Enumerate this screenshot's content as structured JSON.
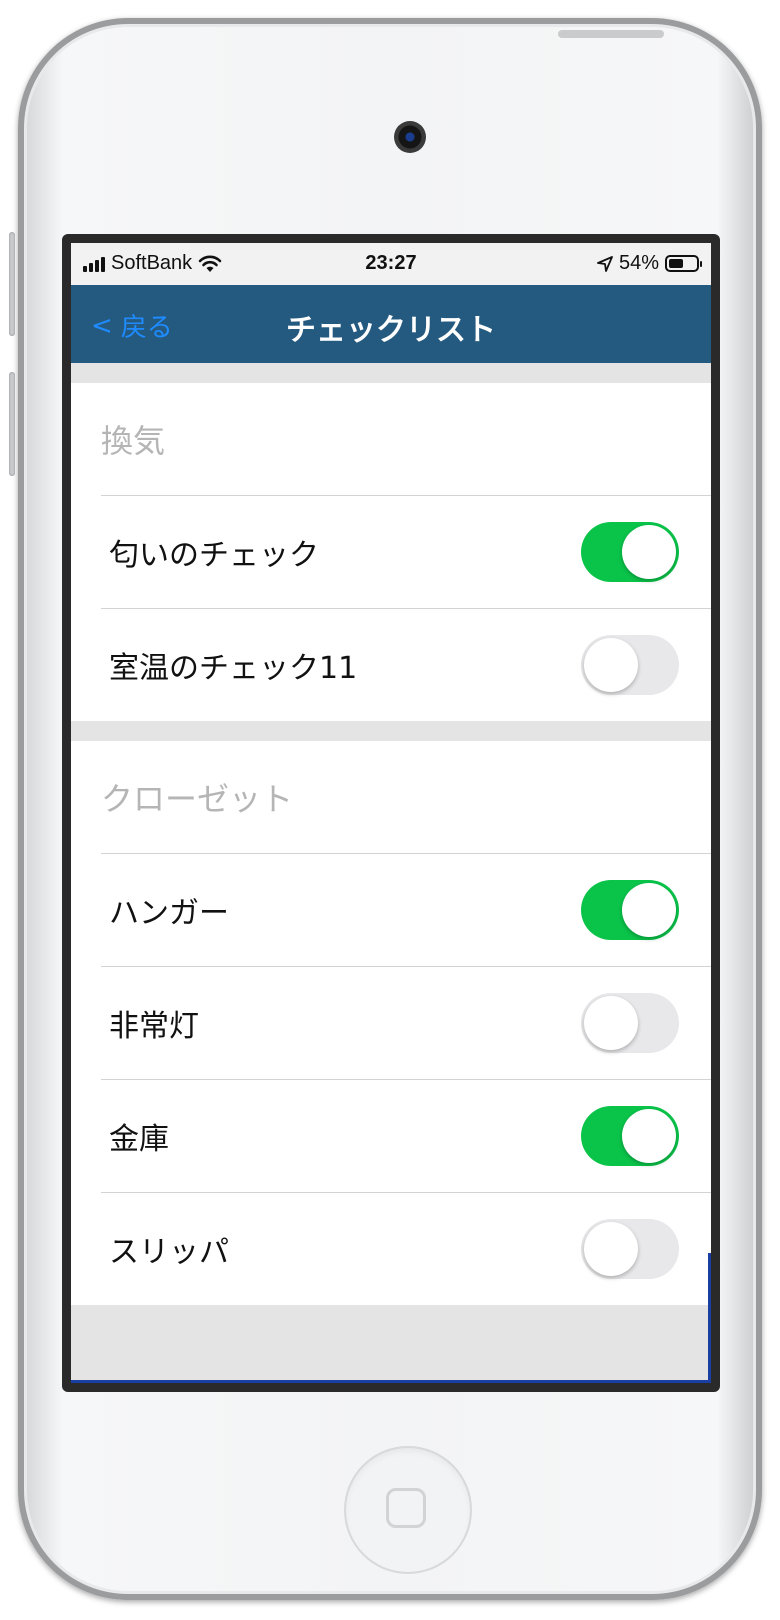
{
  "status_bar": {
    "carrier": "SoftBank",
    "time": "23:27",
    "battery": "54%",
    "battery_level": 0.54
  },
  "nav": {
    "back_label": "戻る",
    "back_icon": "chevron-left-icon",
    "title": "チェックリスト",
    "bg_color": "#255a80"
  },
  "sections": [
    {
      "header": "換気",
      "items": [
        {
          "label": "匂いのチェック",
          "on": true
        },
        {
          "label": "室温のチェック11",
          "on": false
        }
      ]
    },
    {
      "header": "クローゼット",
      "items": [
        {
          "label": "ハンガー",
          "on": true
        },
        {
          "label": "非常灯",
          "on": false
        },
        {
          "label": "金庫",
          "on": true
        },
        {
          "label": "スリッパ",
          "on": false
        }
      ]
    }
  ],
  "colors": {
    "toggle_on": "#0ac44a",
    "toggle_off": "#e8e8ea",
    "back_link": "#1e8bff"
  }
}
